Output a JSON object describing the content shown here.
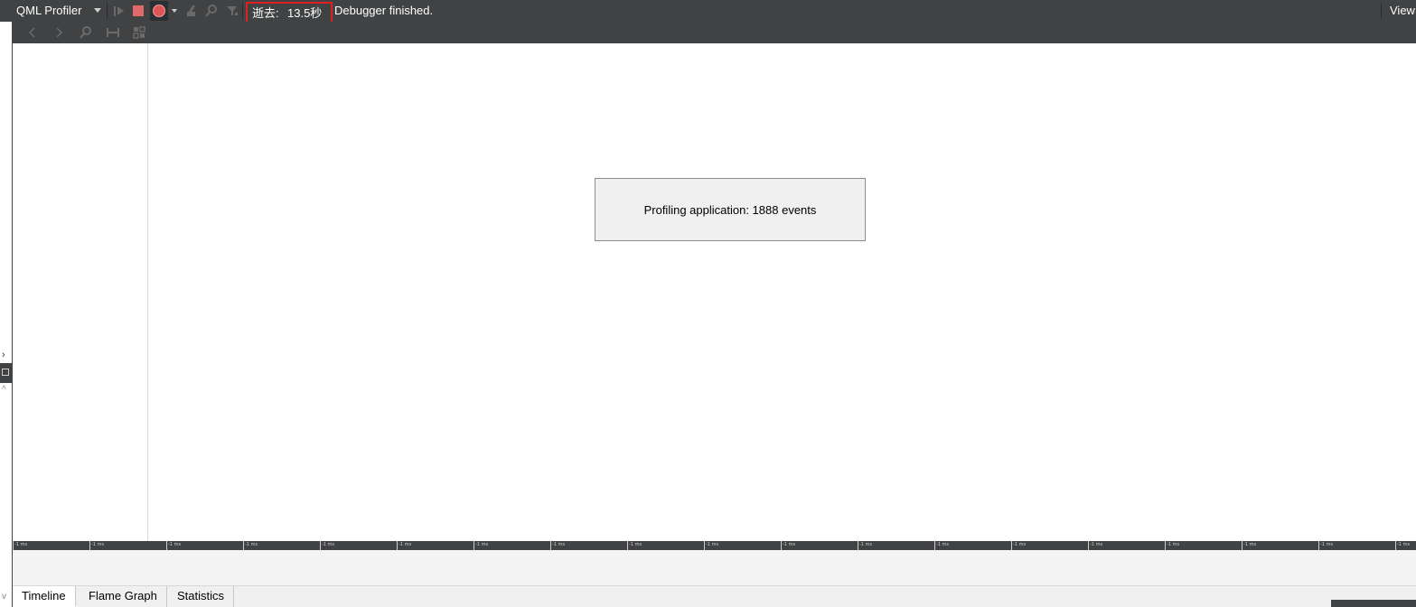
{
  "toolbar": {
    "title": "QML Profiler",
    "elapsed_label": "逝去:",
    "elapsed_value": "13.5秒",
    "status": "Debugger finished.",
    "view_label": "View"
  },
  "icons": {
    "start": "start-profiling-icon",
    "stop": "stop-icon",
    "record": "record-icon",
    "record_menu": "chevron-down-icon",
    "clear": "clear-icon",
    "search": "search-icon",
    "filter": "filter-icon",
    "nav_prev": "chevron-left-icon",
    "nav_next": "chevron-right-icon",
    "zoom": "zoom-icon",
    "range": "range-select-icon",
    "lock": "lock-selection-icon"
  },
  "dialog": {
    "text": "Profiling application: 1888 events"
  },
  "ruler": {
    "tick_label": "-1 ms"
  },
  "tabs": [
    {
      "label": "Timeline",
      "active": true
    },
    {
      "label": "Flame Graph",
      "active": false
    },
    {
      "label": "Statistics",
      "active": false
    }
  ],
  "colors": {
    "toolbar_bg": "#404244",
    "record": "#e05555",
    "stop": "#e06a6a",
    "highlight_box": "#e02020"
  }
}
